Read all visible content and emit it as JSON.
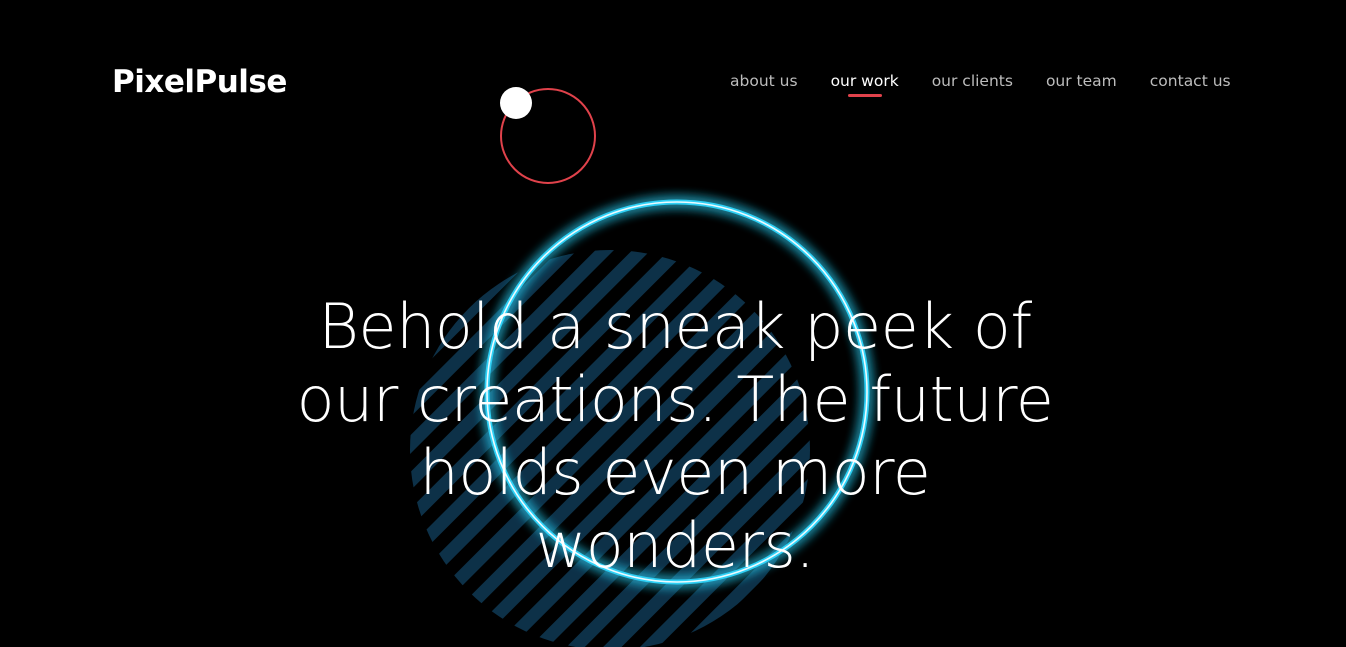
{
  "brand": {
    "name": "PixelPulse"
  },
  "nav": {
    "items": [
      {
        "label": "about us",
        "active": false
      },
      {
        "label": "our work",
        "active": true
      },
      {
        "label": "our clients",
        "active": false
      },
      {
        "label": "our team",
        "active": false
      },
      {
        "label": "contact us",
        "active": false
      }
    ]
  },
  "hero": {
    "headline": "Behold a sneak peek of our creations. The future holds even more wonders."
  },
  "colors": {
    "background": "#000000",
    "accent_red": "#e0424b",
    "neon_cyan": "#2fd0f5",
    "stripe_blue": "#0f3a55",
    "text": "#ffffff",
    "nav_text": "#bdbdbd"
  },
  "icons": {
    "orbit": "orbit-circle-icon",
    "orbit_dot": "orbit-dot-icon",
    "neon_ring": "neon-ring-icon",
    "stripes": "hatch-stripes-icon"
  }
}
